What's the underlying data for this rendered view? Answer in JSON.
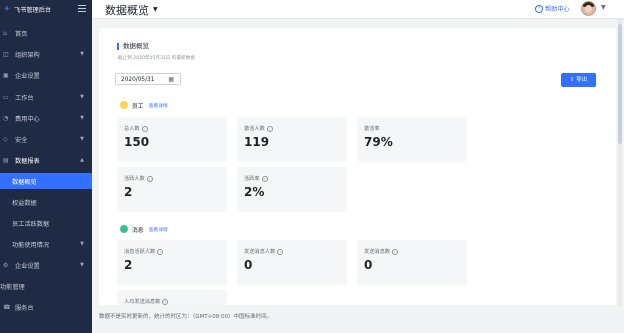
{
  "app": {
    "brand": "飞书管理后台"
  },
  "sidebar": {
    "items": [
      {
        "label": "首页",
        "icon": "home-icon"
      },
      {
        "label": "组织架构",
        "icon": "org-icon"
      },
      {
        "label": "企业设置",
        "icon": "settings-icon"
      },
      {
        "label": "工作台",
        "icon": "workbench-icon"
      },
      {
        "label": "费用中心",
        "icon": "cost-icon"
      },
      {
        "label": "安全",
        "icon": "shield-icon"
      },
      {
        "label": "数据报表",
        "icon": "report-icon"
      },
      {
        "label": "数据概览"
      },
      {
        "label": "权益数据"
      },
      {
        "label": "员工活跃数据"
      },
      {
        "label": "功能使用情况"
      },
      {
        "label": "企业设置",
        "icon": "settings-icon"
      },
      {
        "label": "功能管理",
        "icon": "feature-icon"
      },
      {
        "label": "服务台",
        "icon": "service-icon"
      }
    ]
  },
  "header": {
    "title": "数据概览",
    "help": "帮助中心"
  },
  "overview": {
    "title": "数据概览",
    "subtitle": "截止到 2020年05月31日 的最新数据",
    "date": "2020/05/31",
    "export": "导出"
  },
  "employees": {
    "name": "员工",
    "link": "查看详情",
    "stats": [
      {
        "label": "总人数",
        "value": "150"
      },
      {
        "label": "激活人数",
        "value": "119"
      },
      {
        "label": "激活率",
        "value": "79%"
      },
      {
        "label": "活跃人数",
        "value": "2"
      },
      {
        "label": "活跃率",
        "value": "2%"
      }
    ]
  },
  "messages": {
    "name": "消息",
    "link": "查看详情",
    "stats": [
      {
        "label": "消息活跃人数",
        "value": "2"
      },
      {
        "label": "发送消息人数",
        "value": "0"
      },
      {
        "label": "发送消息数",
        "value": "0"
      },
      {
        "label": "人均发送消息数",
        "value": ""
      }
    ]
  },
  "footer": {
    "note": "数据不是实时更新的，统计的时区为：（GMT+08:00）中国标准时间。"
  },
  "colors": {
    "accent": "#3370ff",
    "sidebar": "#1f2a44"
  }
}
